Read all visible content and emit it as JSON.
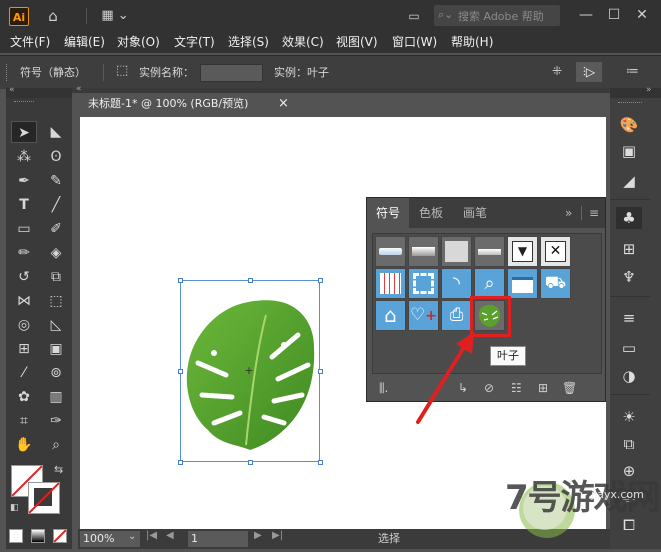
{
  "app": {
    "logo_text": "Ai"
  },
  "titlebar": {
    "search_placeholder": "搜索 Adobe 帮助"
  },
  "menu": [
    "文件(F)",
    "编辑(E)",
    "对象(O)",
    "文字(T)",
    "选择(S)",
    "效果(C)",
    "视图(V)",
    "窗口(W)",
    "帮助(H)"
  ],
  "control_bar": {
    "selection_type": "符号（静态）",
    "instance_name_label": "实例名称：",
    "instance_name_value": "",
    "instance_label": "实例：叶子"
  },
  "document": {
    "tab_title": "未标题-1* @ 100% (RGB/预览)",
    "close_glyph": "×"
  },
  "symbols_panel": {
    "tabs": [
      "符号",
      "色板",
      "画笔"
    ],
    "active_tab": "符号",
    "tooltip": "叶子"
  },
  "status_bar": {
    "zoom": "100%",
    "page": "1",
    "tool": "选择"
  },
  "watermark": {
    "text": "7号游戏网",
    "sub": "jiayx.com"
  },
  "colors": {
    "accent_red": "#e02020",
    "selection_blue": "#4a7fc8",
    "leaf_green": "#5aa02c"
  }
}
